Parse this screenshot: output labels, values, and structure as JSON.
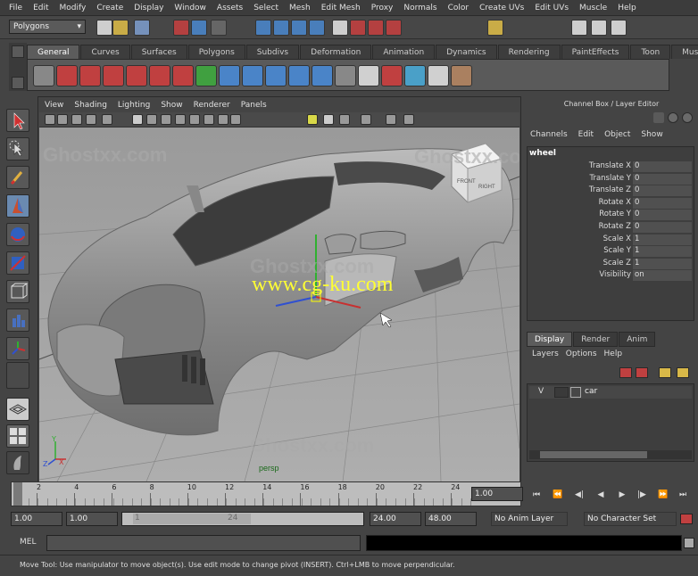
{
  "menubar": [
    "File",
    "Edit",
    "Modify",
    "Create",
    "Display",
    "Window",
    "Assets",
    "Select",
    "Mesh",
    "Edit Mesh",
    "Proxy",
    "Normals",
    "Color",
    "Create UVs",
    "Edit UVs",
    "Muscle",
    "Help"
  ],
  "status_line": {
    "mode": "Polygons"
  },
  "shelf": {
    "tabs": [
      "General",
      "Curves",
      "Surfaces",
      "Polygons",
      "Subdivs",
      "Deformation",
      "Animation",
      "Dynamics",
      "Rendering",
      "PaintEffects",
      "Toon",
      "Muscle"
    ],
    "active_tab": "General"
  },
  "viewport": {
    "menu": [
      "View",
      "Shading",
      "Lighting",
      "Show",
      "Renderer",
      "Panels"
    ],
    "camera_label": "persp",
    "viewcube": {
      "front": "FRONT",
      "right": "RIGHT"
    },
    "watermarks": [
      "Ghostxx.com",
      "www.cg-ku.com"
    ],
    "axis": {
      "x": "X",
      "y": "Y",
      "z": "Z"
    }
  },
  "channel_box": {
    "title": "Channel Box / Layer Editor",
    "menu": [
      "Channels",
      "Edit",
      "Object",
      "Show"
    ],
    "object_name": "wheel",
    "attributes": [
      {
        "name": "Translate X",
        "value": "0"
      },
      {
        "name": "Translate Y",
        "value": "0"
      },
      {
        "name": "Translate Z",
        "value": "0"
      },
      {
        "name": "Rotate X",
        "value": "0"
      },
      {
        "name": "Rotate Y",
        "value": "0"
      },
      {
        "name": "Rotate Z",
        "value": "0"
      },
      {
        "name": "Scale X",
        "value": "1"
      },
      {
        "name": "Scale Y",
        "value": "1"
      },
      {
        "name": "Scale Z",
        "value": "1"
      },
      {
        "name": "Visibility",
        "value": "on"
      }
    ]
  },
  "layer_editor": {
    "tabs": [
      "Display",
      "Render",
      "Anim"
    ],
    "active_tab": "Display",
    "menu": [
      "Layers",
      "Options",
      "Help"
    ],
    "layers": [
      {
        "visible": "V",
        "name": "car"
      }
    ]
  },
  "time_slider": {
    "ticks": [
      "1",
      "2",
      "4",
      "6",
      "8",
      "10",
      "12",
      "14",
      "16",
      "18",
      "20",
      "22",
      "24"
    ],
    "current_frame": "1.00"
  },
  "range_slider": {
    "start": "1.00",
    "anim_start": "1.00",
    "range_start_marker": "1",
    "range_end_marker": "24",
    "anim_end": "24.00",
    "end": "48.00",
    "anim_layer": "No Anim Layer",
    "character_set": "No Character Set"
  },
  "command_line": {
    "label": "MEL"
  },
  "help_line": "Move Tool: Use manipulator to move object(s). Use edit mode to change pivot (INSERT). Ctrl+LMB to move perpendicular.",
  "colors": {
    "accent_active_tab": "#5c5c5c",
    "selection_blue": "#4a84c8",
    "manip_red": "#c83030",
    "manip_green": "#30b030",
    "manip_blue": "#3050d0",
    "watermark_yellow": "#ffff33"
  }
}
